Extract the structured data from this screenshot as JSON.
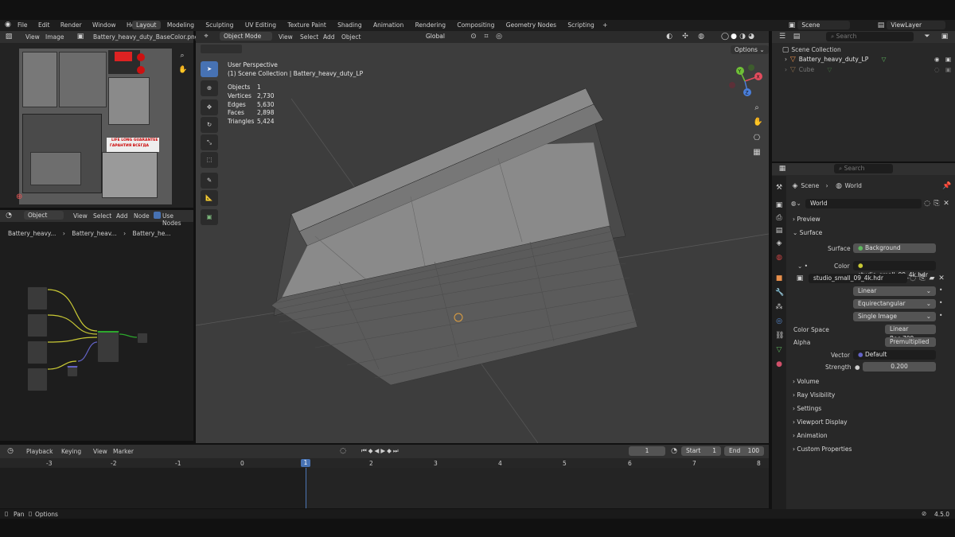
{
  "topbar": {
    "menus": [
      "File",
      "Edit",
      "Render",
      "Window",
      "Help"
    ],
    "workspaces": [
      "Layout",
      "Modeling",
      "Sculpting",
      "UV Editing",
      "Texture Paint",
      "Shading",
      "Animation",
      "Rendering",
      "Compositing",
      "Geometry Nodes",
      "Scripting"
    ],
    "active_workspace": "Layout",
    "plus": "+",
    "scene": "Scene",
    "view_layer": "ViewLayer"
  },
  "image_editor": {
    "menus": [
      "View",
      "Image"
    ],
    "image_name": "Battery_heavy_duty_BaseColor.png",
    "label_1": "LIFE LONG GUARANTEE",
    "label_2": "ГАРАНТИЯ ВСЕГДА"
  },
  "node_editor": {
    "mode": "Object",
    "menus": [
      "View",
      "Select",
      "Add",
      "Node"
    ],
    "use_nodes": "Use Nodes",
    "breadcrumb": [
      "Battery_heavy...",
      "Battery_heav...",
      "Battery_he..."
    ]
  },
  "viewport": {
    "mode": "Object Mode",
    "menus": [
      "View",
      "Select",
      "Add",
      "Object"
    ],
    "transform": "Global",
    "options": "Options",
    "perspective": "User Perspective",
    "collection_line": "(1) Scene Collection | Battery_heavy_duty_LP",
    "stats": [
      {
        "label": "Objects",
        "value": "1"
      },
      {
        "label": "Vertices",
        "value": "2,730"
      },
      {
        "label": "Edges",
        "value": "5,630"
      },
      {
        "label": "Faces",
        "value": "2,898"
      },
      {
        "label": "Triangles",
        "value": "5,424"
      }
    ],
    "gizmo": {
      "x": "X",
      "y": "Y",
      "z": "Z"
    }
  },
  "outliner": {
    "search": "Search",
    "root": "Scene Collection",
    "items": [
      "Battery_heavy_duty_LP",
      "Cube"
    ]
  },
  "properties": {
    "search": "Search",
    "breadcrumb": [
      "Scene",
      "World"
    ],
    "world_name": "World",
    "sections": {
      "preview": "Preview",
      "surface": "Surface",
      "volume": "Volume",
      "ray_visibility": "Ray Visibility",
      "settings": "Settings",
      "viewport_display": "Viewport Display",
      "animation": "Animation",
      "custom_properties": "Custom Properties"
    },
    "surface_label": "Surface",
    "surface_value": "Background",
    "color_label": "Color",
    "color_value": "studio_small_09_4k.hdr",
    "image_name": "studio_small_09_4k.hdr",
    "interpolation": "Linear",
    "projection": "Equirectangular",
    "source": "Single Image",
    "color_space_label": "Color Space",
    "color_space": "Linear Rec.709",
    "alpha_label": "Alpha",
    "alpha": "Premultiplied",
    "vector_label": "Vector",
    "vector": "Default",
    "strength_label": "Strength",
    "strength": "0.200"
  },
  "timeline": {
    "menus": [
      "Playback",
      "Keying",
      "View",
      "Marker"
    ],
    "current_frame": "1",
    "start_label": "Start",
    "start": "1",
    "end_label": "End",
    "end": "100",
    "ticks": [
      "-3",
      "-2",
      "-1",
      "0",
      "1",
      "2",
      "3",
      "4",
      "5",
      "6",
      "7",
      "8"
    ],
    "playhead": "1"
  },
  "statusbar": {
    "pan": "Pan",
    "options": "Options",
    "version": "4.5.0"
  }
}
